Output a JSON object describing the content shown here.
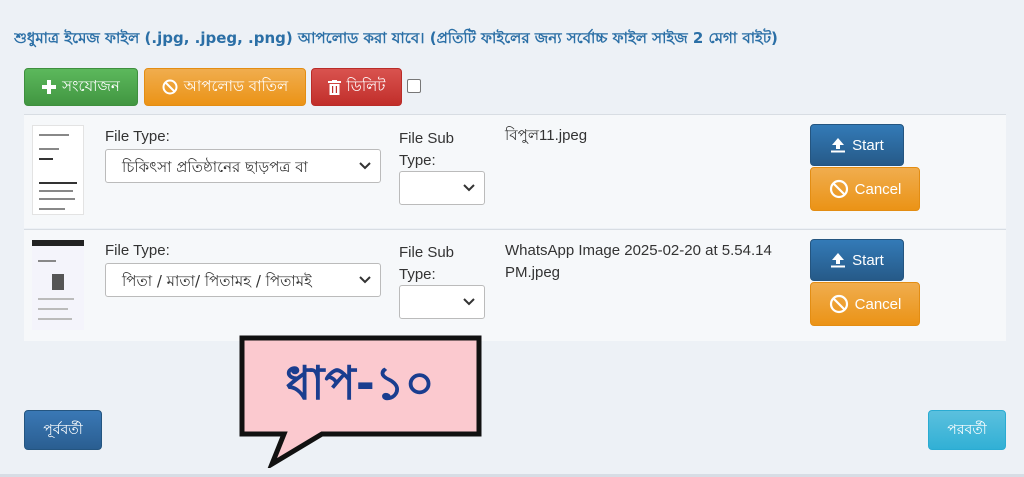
{
  "notice": "শুধুমাত্র ইমেজ ফাইল (.jpg, .jpeg, .png) আপলোড করা যাবে। (প্রতিটি ফাইলের জন্য সর্বোচ্চ ফাইল সাইজ 2 মেগা বাইট)",
  "toolbar": {
    "add_label": "সংযোজন",
    "cancel_upload_label": "আপলোড বাতিল",
    "delete_label": "ডিলিট"
  },
  "files": [
    {
      "file_type_label": "File Type:",
      "file_type_value": "চিকিৎসা প্রতিষ্ঠানের ছাড়পত্র বা",
      "file_sub_type_label": "File Sub Type:",
      "file_sub_type_value": "",
      "file_name": "বিপুল11.jpeg",
      "start_label": "Start",
      "cancel_label": "Cancel"
    },
    {
      "file_type_label": "File Type:",
      "file_type_value": "পিতা / মাতা/ পিতামহ / পিতামই",
      "file_sub_type_label": "File Sub Type:",
      "file_sub_type_value": "",
      "file_name": "WhatsApp Image 2025-02-20 at 5.54.14 PM.jpeg",
      "start_label": "Start",
      "cancel_label": "Cancel"
    }
  ],
  "nav": {
    "prev_label": "পূর্ববর্তী",
    "next_label": "পরবর্তী"
  },
  "step_callout": "ধাপ-১০",
  "colors": {
    "notice_text": "#2b6fa6",
    "success": "#5cb85c",
    "warning": "#f0ad4e",
    "danger": "#d9534f",
    "primary": "#337ab7",
    "info": "#5bc0de",
    "callout_fill": "#fbc9cf",
    "callout_text": "#1a3d8f"
  },
  "icons": {
    "add": "plus-icon",
    "cancel_upload": "ban-icon",
    "delete": "trash-icon",
    "start": "upload-icon",
    "cancel": "ban-icon",
    "select": "chevron-down-icon"
  }
}
